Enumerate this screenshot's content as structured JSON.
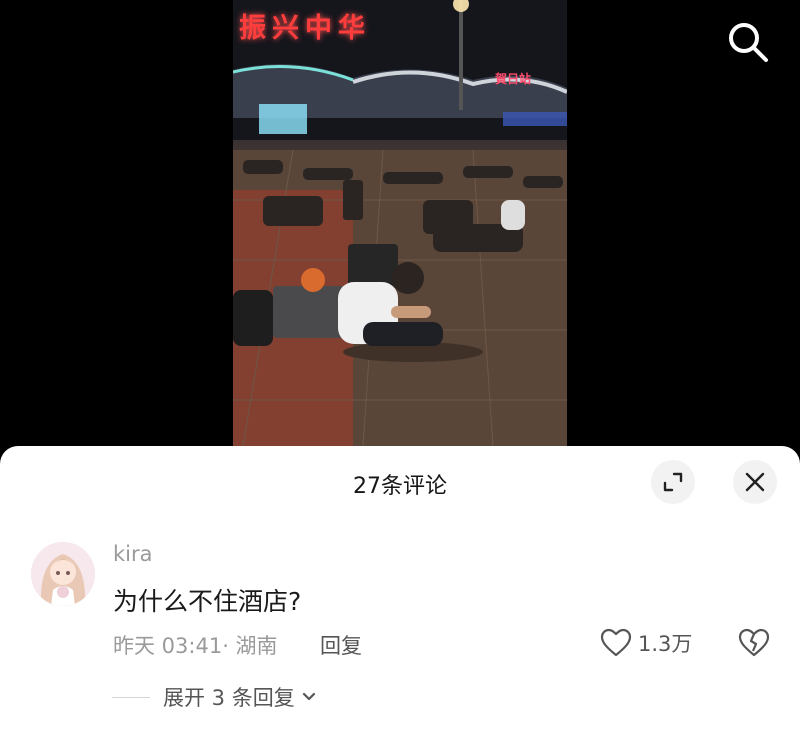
{
  "video": {
    "sign_text": "振兴中华",
    "small_sign_text": "賀日站"
  },
  "icons": {
    "search": "search-icon",
    "expand": "expand-icon",
    "close": "close-icon",
    "heart": "heart-icon",
    "dislike": "broken-heart-icon",
    "chevron": "chevron-down-icon"
  },
  "comments_panel": {
    "title": "27条评论",
    "comments": [
      {
        "username": "kira",
        "text": "为什么不住酒店?",
        "meta": "昨天 03:41· 湖南",
        "reply_label": "回复",
        "like_count": "1.3万",
        "expand_replies_label": "展开 3 条回复"
      }
    ]
  },
  "colors": {
    "sheet_bg": "#ffffff",
    "secondary_text": "#9a9a9a",
    "button_bg": "#f2f2f2"
  }
}
